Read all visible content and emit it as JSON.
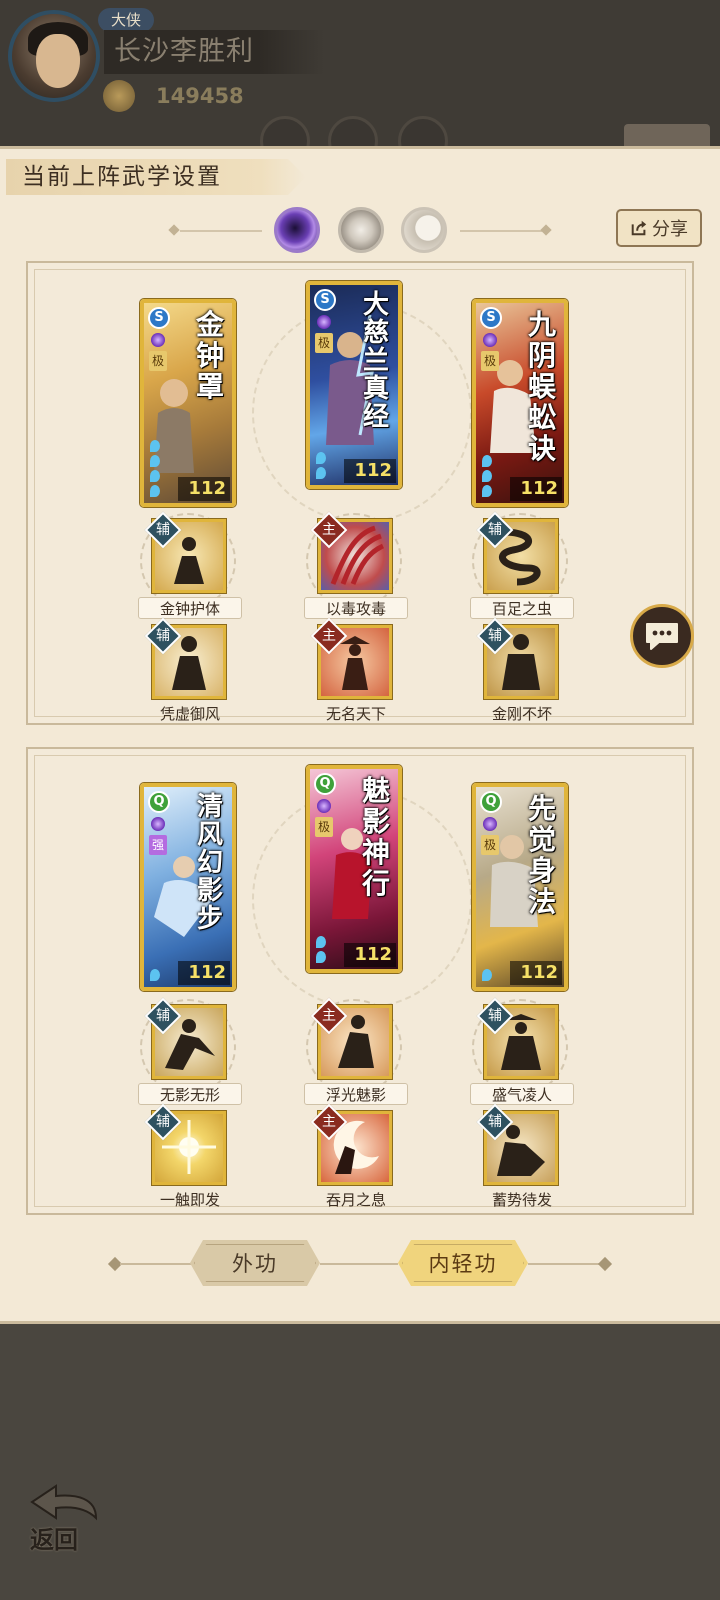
{
  "player": {
    "rank": "大侠",
    "name": "长沙李胜利",
    "currency": "149458"
  },
  "modal": {
    "title": "当前上阵武学设置",
    "share_label": "分享"
  },
  "panels": [
    {
      "cards": [
        {
          "name": "金钟罩",
          "grade": "极",
          "level": "112",
          "type": "S",
          "type_color": "#2d78c7"
        },
        {
          "name": "大慈兰真经",
          "grade": "极",
          "level": "112",
          "type": "S",
          "type_color": "#2d78c7"
        },
        {
          "name": "九阴蜈蚣诀",
          "grade": "极",
          "level": "112",
          "type": "S",
          "type_color": "#2d78c7"
        }
      ],
      "skills_row1": [
        {
          "tag": "辅",
          "label": "金钟护体"
        },
        {
          "tag": "主",
          "label": "以毒攻毒"
        },
        {
          "tag": "辅",
          "label": "百足之虫"
        }
      ],
      "skills_row2": [
        {
          "tag": "辅",
          "label": "凭虚御风"
        },
        {
          "tag": "主",
          "label": "无名天下"
        },
        {
          "tag": "辅",
          "label": "金刚不坏"
        }
      ]
    },
    {
      "cards": [
        {
          "name": "清风幻影步",
          "grade": "强",
          "level": "112",
          "type": "Q",
          "type_color": "#3fa13a"
        },
        {
          "name": "魅影神行",
          "grade": "极",
          "level": "112",
          "type": "Q",
          "type_color": "#3fa13a"
        },
        {
          "name": "先觉身法",
          "grade": "极",
          "level": "112",
          "type": "Q",
          "type_color": "#3fa13a"
        }
      ],
      "skills_row1": [
        {
          "tag": "辅",
          "label": "无影无形"
        },
        {
          "tag": "主",
          "label": "浮光魅影"
        },
        {
          "tag": "辅",
          "label": "盛气凌人"
        }
      ],
      "skills_row2": [
        {
          "tag": "辅",
          "label": "一触即发"
        },
        {
          "tag": "主",
          "label": "吞月之息"
        },
        {
          "tag": "辅",
          "label": "蓄势待发"
        }
      ]
    }
  ],
  "tabs": {
    "outer": "外功",
    "inner": "内轻功",
    "active": "inner"
  },
  "footer": {
    "back_label": "返回"
  },
  "icons": [
    "purple-orb-icon",
    "silver-orb-icon",
    "moon-orb-icon",
    "share-icon",
    "chat-bubble-icon",
    "back-arrow-icon",
    "coin-icon"
  ]
}
